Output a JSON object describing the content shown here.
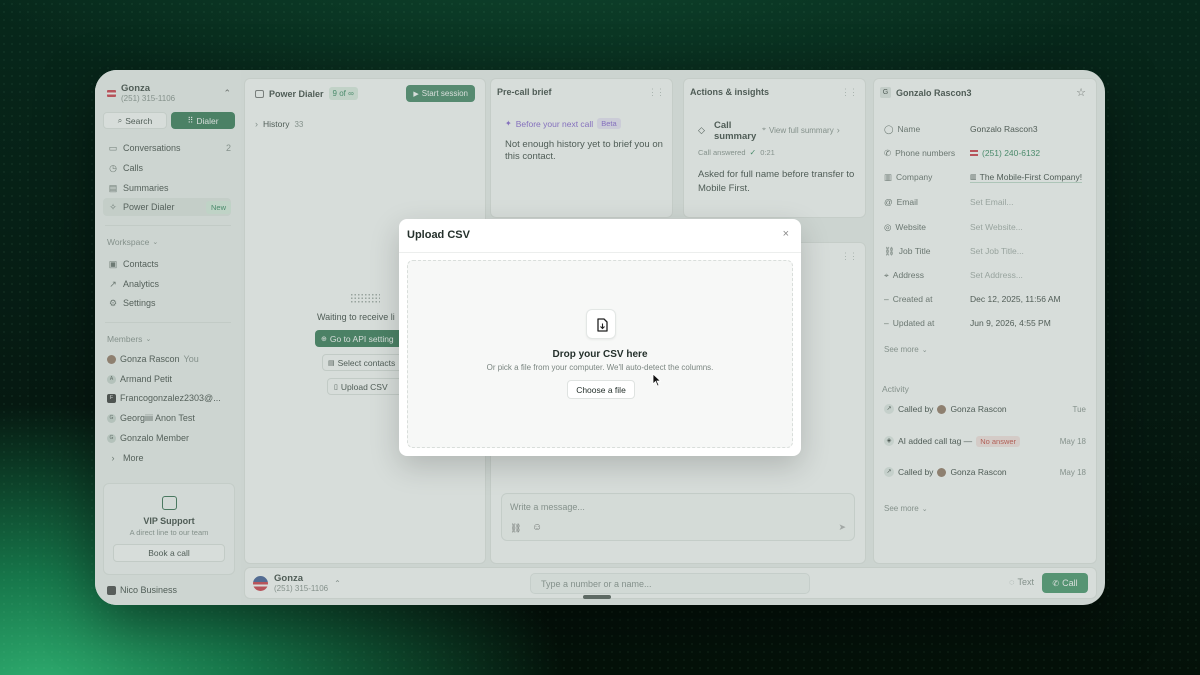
{
  "account": {
    "name": "Gonza",
    "phone": "(251) 315-1106"
  },
  "top_buttons": {
    "search": "Search",
    "dialer": "Dialer"
  },
  "nav": [
    {
      "label": "Conversations",
      "count": "2",
      "icon": "chat-icon"
    },
    {
      "label": "Calls",
      "icon": "clock-icon"
    },
    {
      "label": "Summaries",
      "icon": "doc-icon"
    },
    {
      "label": "Power Dialer",
      "badge": "New",
      "icon": "bolt-icon"
    }
  ],
  "workspace": {
    "heading": "Workspace",
    "items": [
      {
        "label": "Contacts",
        "icon": "contacts-icon"
      },
      {
        "label": "Analytics",
        "icon": "chart-icon"
      },
      {
        "label": "Settings",
        "icon": "gear-icon"
      }
    ]
  },
  "members": {
    "heading": "Members",
    "items": [
      {
        "label": "Gonza Rascon",
        "suffix": "You",
        "initial": ""
      },
      {
        "label": "Armand Petit",
        "initial": "A"
      },
      {
        "label": "Francogonzalez2303@...",
        "initial": "F"
      },
      {
        "label": "Georgiiii Anon Test",
        "initial": "G"
      },
      {
        "label": "Gonzalo Member",
        "initial": "G"
      },
      {
        "label": "More",
        "initial": "›"
      }
    ]
  },
  "vip": {
    "title": "VIP Support",
    "subtitle": "A direct line to our team",
    "button": "Book a call"
  },
  "footer_org": "Nico Business",
  "power_dialer": {
    "title": "Power Dialer",
    "count": "9 of",
    "infinity": "∞",
    "start": "Start session",
    "history": "History",
    "history_count": "33",
    "waiting": "Waiting to receive li",
    "api_button": "Go to API setting",
    "select_contacts": "Select contacts",
    "upload_csv": "Upload CSV"
  },
  "precall": {
    "title": "Pre-call brief",
    "next_call": "Before your next call",
    "beta": "Beta",
    "text": "Not enough history yet to brief you on this contact."
  },
  "actions": {
    "title": "Actions & insights",
    "summary_title": "Call summary",
    "view_full": "View full summary",
    "status": "Call answered",
    "duration": "0:21",
    "text": "Asked for full name before transfer to Mobile First."
  },
  "message": {
    "placeholder": "Write a message..."
  },
  "contact": {
    "initial": "G",
    "name": "Gonzalo Rascon3",
    "fields": [
      {
        "label": "Name",
        "value": "Gonzalo Rascon3",
        "kind": "val",
        "icon": "user-icon"
      },
      {
        "label": "Phone numbers",
        "value": "(251) 240-6132",
        "kind": "link",
        "icon": "phone-icon"
      },
      {
        "label": "Company",
        "value": "The Mobile-First Company!",
        "kind": "tag",
        "icon": "building-icon"
      },
      {
        "label": "Email",
        "value": "Set Email...",
        "kind": "ph",
        "icon": "at-icon"
      },
      {
        "label": "Website",
        "value": "Set Website...",
        "kind": "ph",
        "icon": "globe-icon"
      },
      {
        "label": "Job Title",
        "value": "Set Job Title...",
        "kind": "ph",
        "icon": "link-icon"
      },
      {
        "label": "Address",
        "value": "Set Address...",
        "kind": "ph",
        "icon": "pin-icon"
      },
      {
        "label": "Created at",
        "value": "Dec 12, 2025, 11:56 AM",
        "kind": "val",
        "icon": "dash-icon"
      },
      {
        "label": "Updated at",
        "value": "Jun 9, 2026, 4:55 PM",
        "kind": "val",
        "icon": "dash-icon"
      }
    ],
    "see_more": "See more",
    "activity_heading": "Activity",
    "activity": [
      {
        "text": "Called by",
        "who": "Gonza Rascon",
        "tag": "",
        "date": "Tue"
      },
      {
        "text": "AI added call tag —",
        "who": "",
        "tag": "No answer",
        "date": "May 18"
      },
      {
        "text": "Called by",
        "who": "Gonza Rascon",
        "tag": "",
        "date": "May 18"
      }
    ],
    "see_more_2": "See more"
  },
  "bottom": {
    "name": "Gonza",
    "phone": "(251) 315-1106",
    "input_placeholder": "Type a number or a name...",
    "text_button": "Text",
    "call_button": "Call"
  },
  "modal": {
    "title": "Upload CSV",
    "drop_title": "Drop your CSV here",
    "drop_subtitle": "Or pick a file from your computer. We'll auto-detect the columns.",
    "choose": "Choose a file"
  }
}
